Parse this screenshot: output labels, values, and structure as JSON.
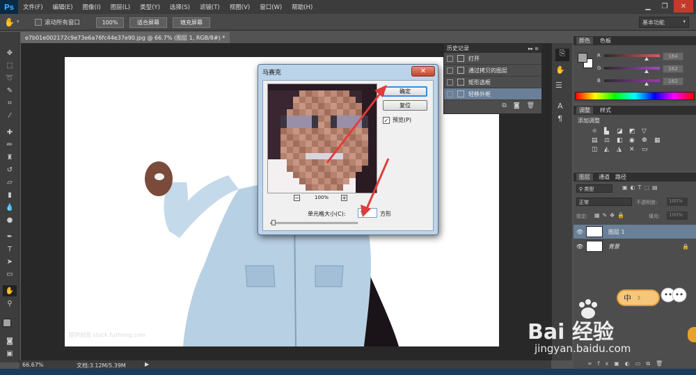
{
  "app": {
    "logo": "Ps"
  },
  "menu": [
    "文件(F)",
    "编辑(E)",
    "图像(I)",
    "图层(L)",
    "类型(Y)",
    "选择(S)",
    "滤镜(T)",
    "视图(V)",
    "窗口(W)",
    "帮助(H)"
  ],
  "window_controls": {
    "minimize": "▁",
    "restore": "❐",
    "close": "✕"
  },
  "options_bar": {
    "scroll_all_label": "滚动所有窗口",
    "zoom_100": "100%",
    "fit_screen": "适合屏幕",
    "fill_screen": "填充屏幕",
    "workspace": "基本功能"
  },
  "document": {
    "tab_title": "e7b01e002172c9e73e6a76fc44e37e90.jpg @ 66.7% (图层 1, RGB/8#) *",
    "tab_close": "×",
    "watermark": "提供创意 stock.fuzhong.com"
  },
  "status": {
    "zoom": "66.67%",
    "doc_size": "文档:3.12M/5.39M"
  },
  "history": {
    "title": "历史记录",
    "items": [
      "打开",
      "通过拷贝的图层",
      "矩形选框",
      "轻移外框"
    ]
  },
  "color_panel": {
    "tabs": [
      "颜色",
      "色板"
    ],
    "channels": [
      {
        "label": "R",
        "value": "164",
        "gradient": "#e05a5a"
      },
      {
        "label": "G",
        "value": "162",
        "gradient": "#a648c8"
      },
      {
        "label": "B",
        "value": "162",
        "gradient": "#9a3ab8"
      }
    ],
    "foreground": "#a4a2a2",
    "background": "#ffffff"
  },
  "adjustments": {
    "tabs": [
      "调整",
      "样式"
    ],
    "title": "添加调整"
  },
  "layers": {
    "tabs": [
      "图层",
      "通道",
      "路径"
    ],
    "filter": "类型",
    "blend_mode": "正常",
    "opacity_label": "不透明度:",
    "opacity_value": "100%",
    "lock_label": "锁定:",
    "fill_label": "填充:",
    "fill_value": "100%",
    "items": [
      {
        "name": "图层 1",
        "selected": true
      },
      {
        "name": "背景",
        "selected": false
      }
    ]
  },
  "dialog": {
    "title": "马赛克",
    "ok": "确定",
    "reset": "复位",
    "preview_label": "预览(P)",
    "zoom_out": "−",
    "zoom_in": "+",
    "zoom_value": "100%",
    "cell_size_label": "单元格大小(C):",
    "cell_size_value": "9",
    "unit": "方形"
  },
  "ime": {
    "label": "中"
  },
  "watermark_site": {
    "brand": "Bai  经验",
    "url": "jingyan.baidu.com"
  }
}
